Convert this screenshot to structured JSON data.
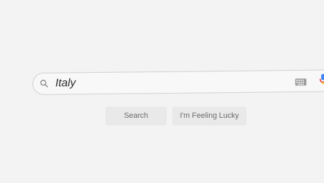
{
  "search": {
    "query": "Italy",
    "search_icon": "magnifier-icon",
    "keyboard_icon": "keyboard-icon",
    "mic_icon": "microphone-icon"
  },
  "buttons": {
    "search_label": "Search",
    "lucky_label": "I'm Feeling Lucky"
  },
  "colors": {
    "background": "#f3f3f3",
    "button_bg": "#e9e9e9",
    "button_text": "#6a6a6a",
    "mic_blue": "#4285f4",
    "mic_red": "#ea4335"
  }
}
